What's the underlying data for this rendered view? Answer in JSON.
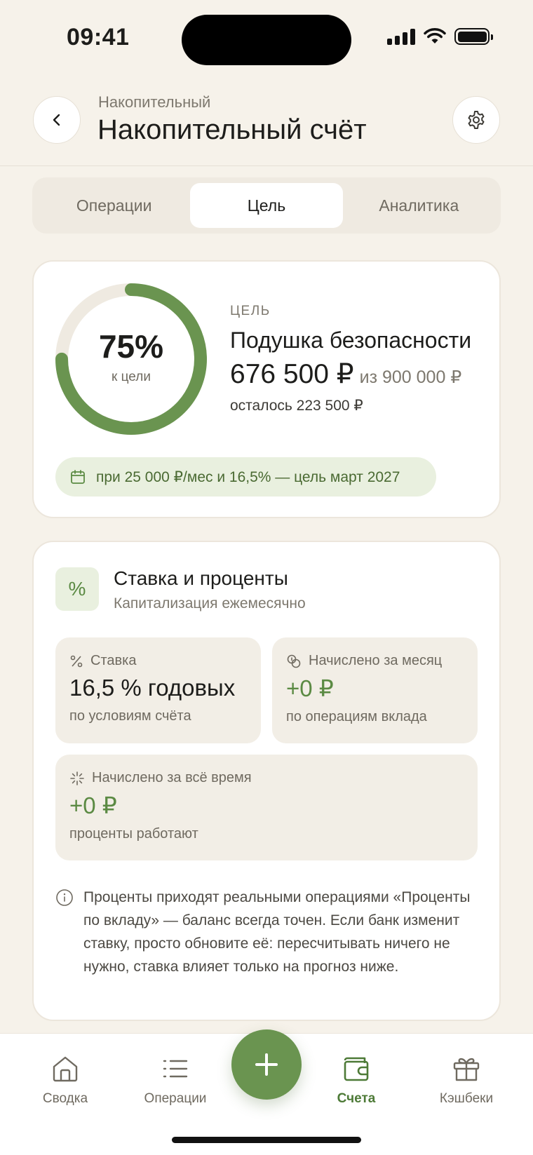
{
  "status_bar": {
    "time": "09:41"
  },
  "header": {
    "subtitle": "Накопительный",
    "title": "Накопительный счёт"
  },
  "tabs": [
    {
      "label": "Операции",
      "active": false
    },
    {
      "label": "Цель",
      "active": true
    },
    {
      "label": "Аналитика",
      "active": false
    }
  ],
  "goal": {
    "progress": 0.75,
    "percent_label": "75%",
    "percent_caption": "к цели",
    "eyebrow": "ЦЕЛЬ",
    "name": "Подушка безопасности",
    "current": "676 500 ₽",
    "target": "из 900 000 ₽",
    "remaining": "осталось 223 500 ₽",
    "forecast": "при 25 000 ₽/мес и 16,5% — цель март 2027"
  },
  "rate": {
    "icon": "%",
    "title": "Ставка и проценты",
    "subtitle": "Капитализация ежемесячно",
    "tiles": {
      "rate": {
        "label": "Ставка",
        "value": "16,5 % годовых",
        "note": "по условиям счёта"
      },
      "month": {
        "label": "Начислено за месяц",
        "value": "+0 ₽",
        "note": "по операциям вклада"
      },
      "all_time": {
        "label": "Начислено за всё время",
        "value": "+0 ₽",
        "note": "проценты работают"
      }
    },
    "info": "Проценты приходят реальными операциями «Проценты по вкладу» — баланс всегда точен. Если банк изменит ставку, просто обновите её: пересчитывать ничего не нужно, ставка влияет только на прогноз ниже."
  },
  "nav": [
    {
      "label": "Сводка",
      "icon": "home-icon"
    },
    {
      "label": "Операции",
      "icon": "list-icon"
    },
    {
      "label": "Счета",
      "icon": "wallet-icon",
      "active": true
    },
    {
      "label": "Кэшбеки",
      "icon": "gift-icon"
    }
  ],
  "colors": {
    "accent": "#6a9450",
    "ring_track": "#efeae1",
    "background": "#f6f2ea"
  }
}
